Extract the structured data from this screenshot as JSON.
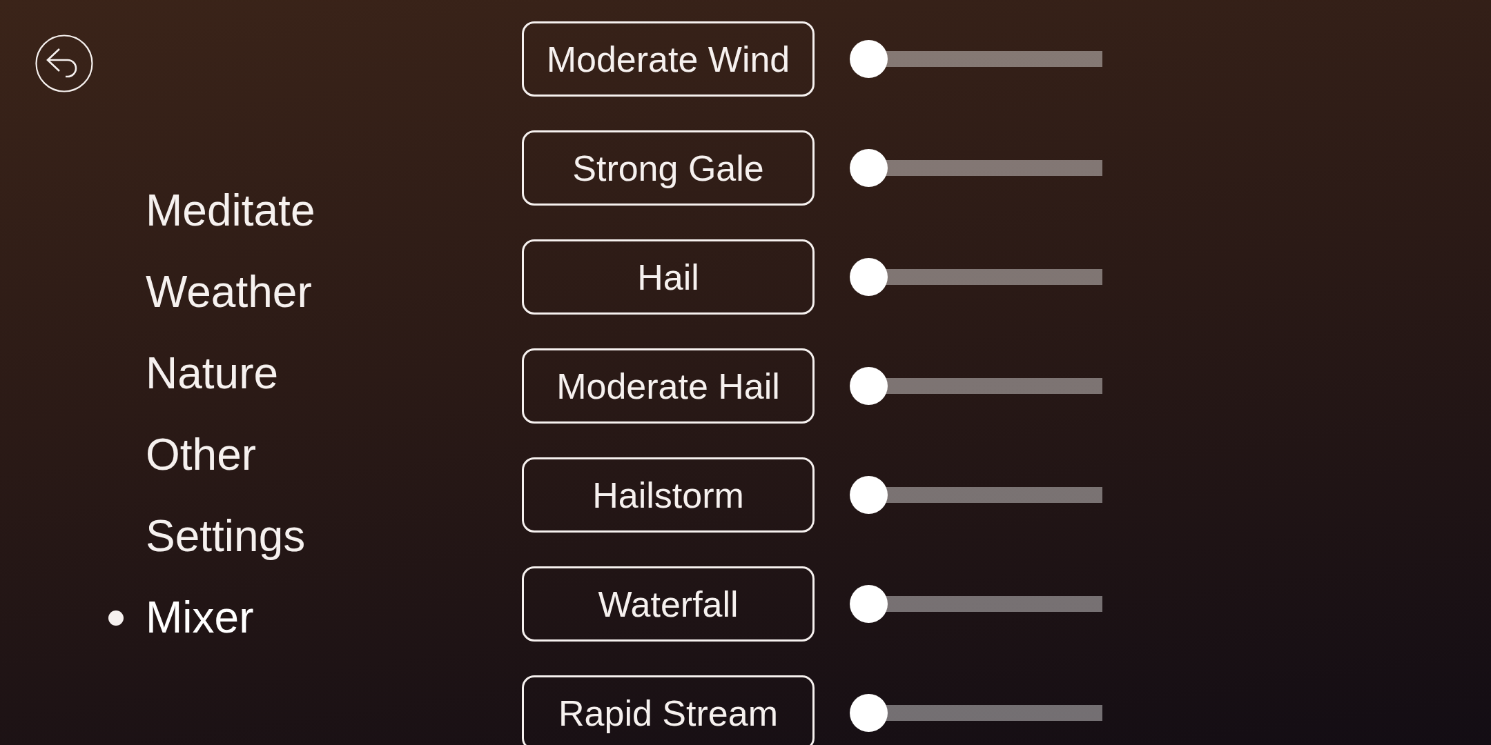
{
  "menu": [
    {
      "label": "Meditate",
      "selected": false
    },
    {
      "label": "Weather",
      "selected": false
    },
    {
      "label": "Nature",
      "selected": false
    },
    {
      "label": "Other",
      "selected": false
    },
    {
      "label": "Settings",
      "selected": false
    },
    {
      "label": "Mixer",
      "selected": true
    }
  ],
  "mixer": [
    {
      "name": "Moderate Wind",
      "level": 0
    },
    {
      "name": "Strong Gale",
      "level": 0
    },
    {
      "name": "Hail",
      "level": 0
    },
    {
      "name": "Moderate Hail",
      "level": 0
    },
    {
      "name": "Hailstorm",
      "level": 0
    },
    {
      "name": "Waterfall",
      "level": 0
    },
    {
      "name": "Rapid Stream",
      "level": 0
    }
  ]
}
